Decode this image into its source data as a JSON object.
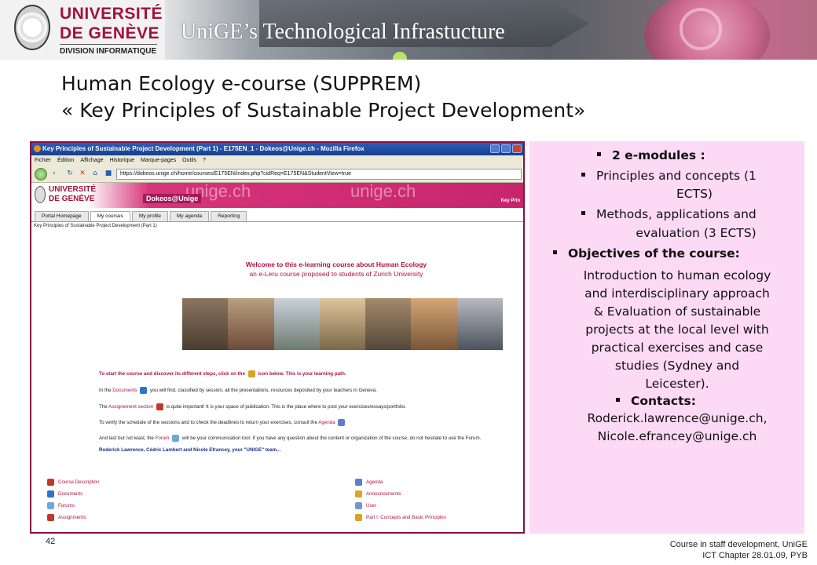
{
  "header": {
    "logo": {
      "line1": "UNIVERSITÉ",
      "line2": "DE GENÈVE",
      "line3": "DIVISION INFORMATIQUE"
    },
    "title": "UniGE’s Technological Infrastucture"
  },
  "slide": {
    "title_line1": "Human Ecology e-course (SUPPREM)",
    "title_line2": "« Key Principles of Sustainable Project Development»"
  },
  "screenshot": {
    "window_title": "Key Principles of Sustainable Project Development (Part 1) - E175EN_1 - Dokeos@Unige.ch - Mozilla Firefox",
    "menu": [
      "Fichier",
      "Édition",
      "Affichage",
      "Historique",
      "Marque-pages",
      "Outils",
      "?"
    ],
    "url": "https://dokeos.unige.ch/home/courses/E175EN/index.php?cidReq=E175EN&StudentView=true",
    "site": {
      "logo_line1": "UNIVERSITÉ",
      "logo_line2": "DE GENÈVE",
      "badge": "Dokeos@Unige",
      "watermark1": "unige.ch",
      "watermark2": "unige.ch",
      "corner": "Key Prin"
    },
    "tabs": [
      "Portal Homepage",
      "My courses",
      "My profile",
      "My agenda",
      "Reporting"
    ],
    "breadcrumb": "Key Principles of Sustainable Project Development (Part 1)",
    "welcome_line1": "Welcome to this e-learning course about Human Ecology",
    "welcome_line2": "an e-Leru course proposed to students of Zurich University",
    "lines": {
      "l1a": "To start the course and discover its different steps, click on the",
      "l1b": "icon below.  This is your learning path.",
      "l2a": "In the",
      "l2b": "Documents",
      "l2c": "you will find, classified by session, all the presentations, resources deposited by your teachers in Geneva.",
      "l3a": "The",
      "l3b": "Assignement section",
      "l3c": "is quite important! It is your space of publication. This is the place where to post your exercises/essays/portfolio.",
      "l4a": "To verify the schedule of the sessions and to check the deadlines to return your exercises, consult the",
      "l4b": "Agenda",
      "l5a": "And last but not least, the",
      "l5b": "Forum",
      "l5c": "will be your communication tool. If you have any question about the content or organization of the course, do not hesitate to use the Forum.",
      "l6": "Roderick Lawrence, Cédric Lambert and Nicole Efrancey, your \"UNIGE\" team..."
    },
    "tools_left": [
      "Course Description",
      "Documents",
      "Forums",
      "Assignments"
    ],
    "tools_right": [
      "Agenda",
      "Announcements",
      "User",
      "Part I: Concepts and Basic Principles"
    ]
  },
  "panel": {
    "b1": "2 e-modules :",
    "b1a_l1": "Principles and concepts (1",
    "b1a_l2": "ECTS)",
    "b1b_l1": "Methods, applications and",
    "b1b_l2": "evaluation (3 ECTS)",
    "b2": "Objectives of the course:",
    "obj": [
      "Introduction to human ecology",
      "and interdisciplinary approach",
      "& Evaluation of sustainable",
      "projects at the local level with",
      "practical exercises and case",
      "studies (Sydney and",
      "Leicester)."
    ],
    "contacts_label": "Contacts:",
    "contacts_line1": "Roderick.lawrence@unige.ch,",
    "contacts_line2": "Nicole.efrancey@unige.ch"
  },
  "footer": {
    "page_number": "42",
    "line1": "Course in staff development, UniGE",
    "line2": "ICT Chapter 28.01.09, PYB"
  },
  "colors": {
    "brand": "#a2123a",
    "panel_bg": "#fcd9f4",
    "frame": "#8c0f45"
  }
}
